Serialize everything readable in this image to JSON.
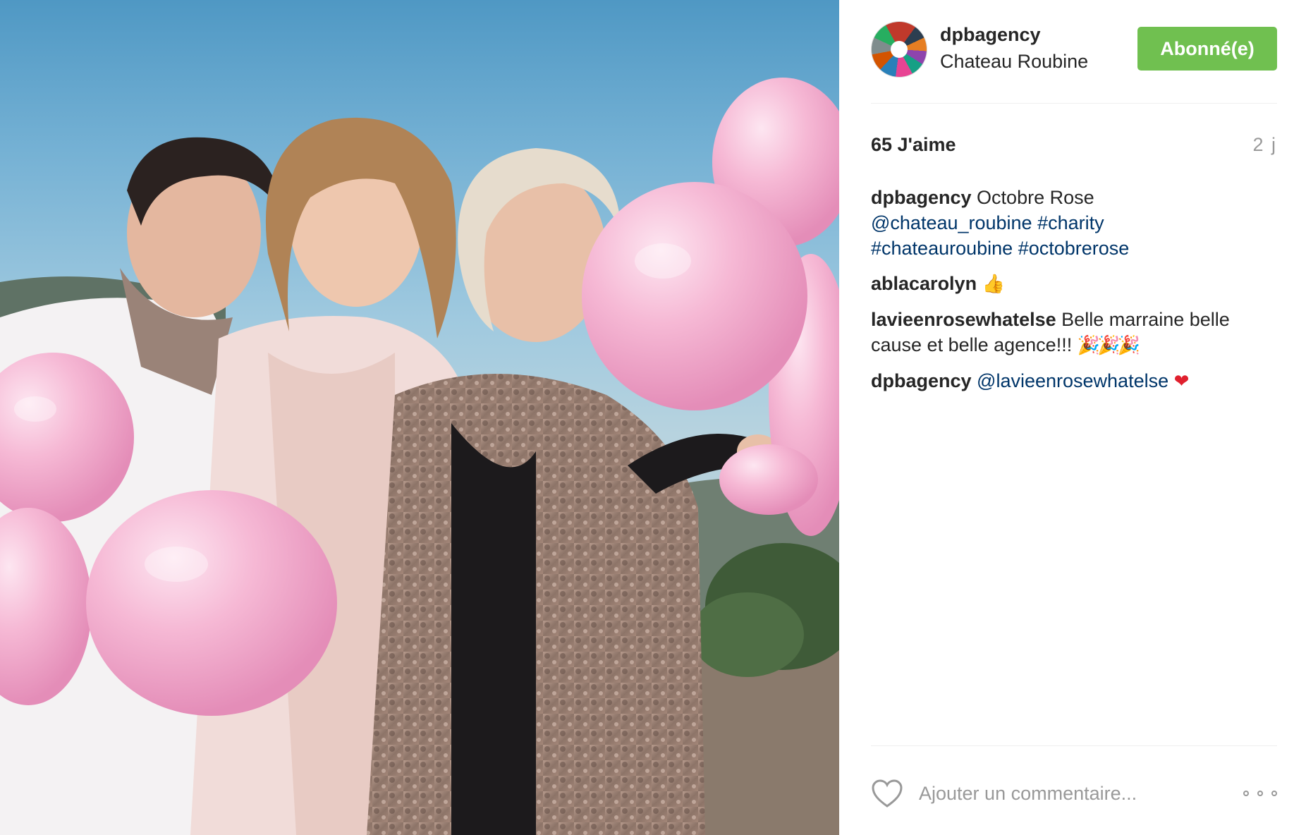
{
  "post": {
    "image_alt": "Photo",
    "author": "dpbagency",
    "location": "Chateau Roubine",
    "follow_label": "Abonné(e)",
    "likes_text": "65 J'aime",
    "time_ago": "2 j"
  },
  "caption": {
    "user": "dpbagency",
    "text": "Octobre Rose",
    "mention": "@chateau_roubine",
    "hashtags": [
      "#charity",
      "#chateauroubine",
      "#octobrerose"
    ]
  },
  "comments": [
    {
      "user": "ablacarolyn",
      "text": "",
      "emoji": "👍"
    },
    {
      "user": "lavieenrosewhatelse",
      "text": "Belle marraine belle cause et belle agence!!!",
      "emoji": "🎉🎉🎉"
    },
    {
      "user": "dpbagency",
      "mention": "@lavieenrosewhatelse",
      "emoji": "❤"
    }
  ],
  "comment_bar": {
    "placeholder": "Ajouter un commentaire...",
    "like_icon": "heart-outline-icon",
    "more_icon": "more-options-icon"
  },
  "colors": {
    "follow_green": "#70c050",
    "link_blue": "#003569",
    "muted_gray": "#999999",
    "balloon_pink": "#f5b5d2"
  }
}
